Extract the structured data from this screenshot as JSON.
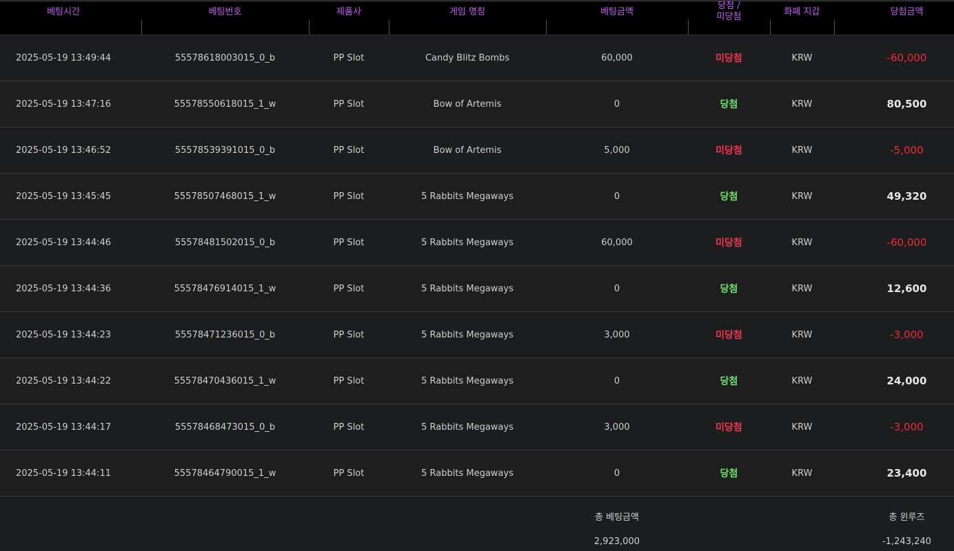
{
  "table": {
    "headers": {
      "bet_time": "베팅시간",
      "bet_number": "베팅번호",
      "provider": "제품사",
      "game_name": "게임 명칭",
      "bet_amount": "베팅금액",
      "result_line1": "당첨 /",
      "result_line2": "미당첨",
      "currency_wallet": "화폐 지갑",
      "win_amount": "당첨금액"
    },
    "rows": [
      {
        "time": "2025-05-19 13:49:44",
        "bet_no": "55578618003015_0_b",
        "provider": "PP Slot",
        "game": "Candy Blitz Bombs",
        "bet": "60,000",
        "result": "미당첨",
        "result_type": "lose",
        "currency": "KRW",
        "amount": "-60,000"
      },
      {
        "time": "2025-05-19 13:47:16",
        "bet_no": "55578550618015_1_w",
        "provider": "PP Slot",
        "game": "Bow of Artemis",
        "bet": "0",
        "result": "당첨",
        "result_type": "win",
        "currency": "KRW",
        "amount": "80,500"
      },
      {
        "time": "2025-05-19 13:46:52",
        "bet_no": "55578539391015_0_b",
        "provider": "PP Slot",
        "game": "Bow of Artemis",
        "bet": "5,000",
        "result": "미당첨",
        "result_type": "lose",
        "currency": "KRW",
        "amount": "-5,000"
      },
      {
        "time": "2025-05-19 13:45:45",
        "bet_no": "55578507468015_1_w",
        "provider": "PP Slot",
        "game": "5 Rabbits Megaways",
        "bet": "0",
        "result": "당첨",
        "result_type": "win",
        "currency": "KRW",
        "amount": "49,320"
      },
      {
        "time": "2025-05-19 13:44:46",
        "bet_no": "55578481502015_0_b",
        "provider": "PP Slot",
        "game": "5 Rabbits Megaways",
        "bet": "60,000",
        "result": "미당첨",
        "result_type": "lose",
        "currency": "KRW",
        "amount": "-60,000"
      },
      {
        "time": "2025-05-19 13:44:36",
        "bet_no": "55578476914015_1_w",
        "provider": "PP Slot",
        "game": "5 Rabbits Megaways",
        "bet": "0",
        "result": "당첨",
        "result_type": "win",
        "currency": "KRW",
        "amount": "12,600"
      },
      {
        "time": "2025-05-19 13:44:23",
        "bet_no": "55578471236015_0_b",
        "provider": "PP Slot",
        "game": "5 Rabbits Megaways",
        "bet": "3,000",
        "result": "미당첨",
        "result_type": "lose",
        "currency": "KRW",
        "amount": "-3,000"
      },
      {
        "time": "2025-05-19 13:44:22",
        "bet_no": "55578470436015_1_w",
        "provider": "PP Slot",
        "game": "5 Rabbits Megaways",
        "bet": "0",
        "result": "당첨",
        "result_type": "win",
        "currency": "KRW",
        "amount": "24,000"
      },
      {
        "time": "2025-05-19 13:44:17",
        "bet_no": "55578468473015_0_b",
        "provider": "PP Slot",
        "game": "5 Rabbits Megaways",
        "bet": "3,000",
        "result": "미당첨",
        "result_type": "lose",
        "currency": "KRW",
        "amount": "-3,000"
      },
      {
        "time": "2025-05-19 13:44:11",
        "bet_no": "55578464790015_1_w",
        "provider": "PP Slot",
        "game": "5 Rabbits Megaways",
        "bet": "0",
        "result": "당첨",
        "result_type": "win",
        "currency": "KRW",
        "amount": "23,400"
      }
    ]
  },
  "footer": {
    "total_bet_label": "총 베팅금액",
    "total_bet_value": "2,923,000",
    "total_winloss_label": "총 윈루즈",
    "total_winloss_value": "-1,243,240"
  },
  "colors": {
    "header_text": "#c45bf5",
    "lose": "#f0364f",
    "win": "#6be36b",
    "negative_amount": "#ef2b36"
  }
}
